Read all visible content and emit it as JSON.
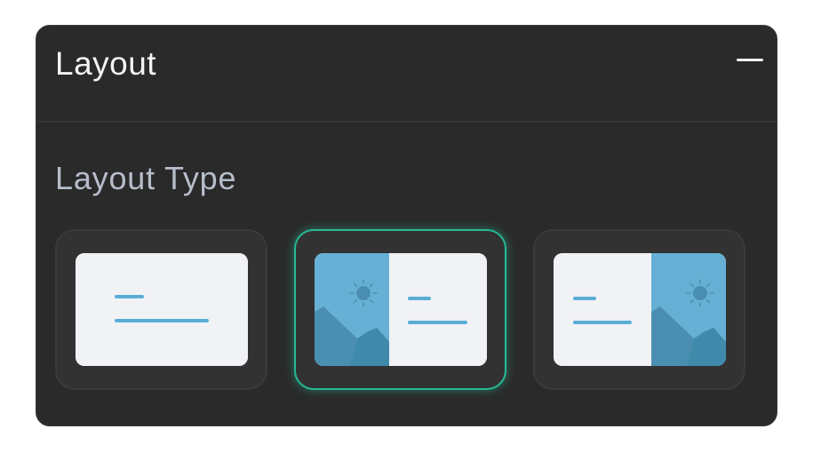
{
  "panel": {
    "title": "Layout",
    "collapse_icon": "minus-icon"
  },
  "layout_type": {
    "label": "Layout Type",
    "selected_index": 1,
    "options": [
      {
        "id": "text-only",
        "icon": "text-only-layout-icon"
      },
      {
        "id": "image-left",
        "icon": "image-left-layout-icon"
      },
      {
        "id": "image-right",
        "icon": "image-right-layout-icon"
      }
    ]
  },
  "colors": {
    "panel_bg": "#2a2a2a",
    "card_bg": "#323232",
    "selected_border": "#27b993",
    "preview_bg": "#f1f2f6",
    "image_sky": "#66b0d6",
    "image_mountain": "#4a8fb2",
    "text_line": "#5aaed6"
  }
}
